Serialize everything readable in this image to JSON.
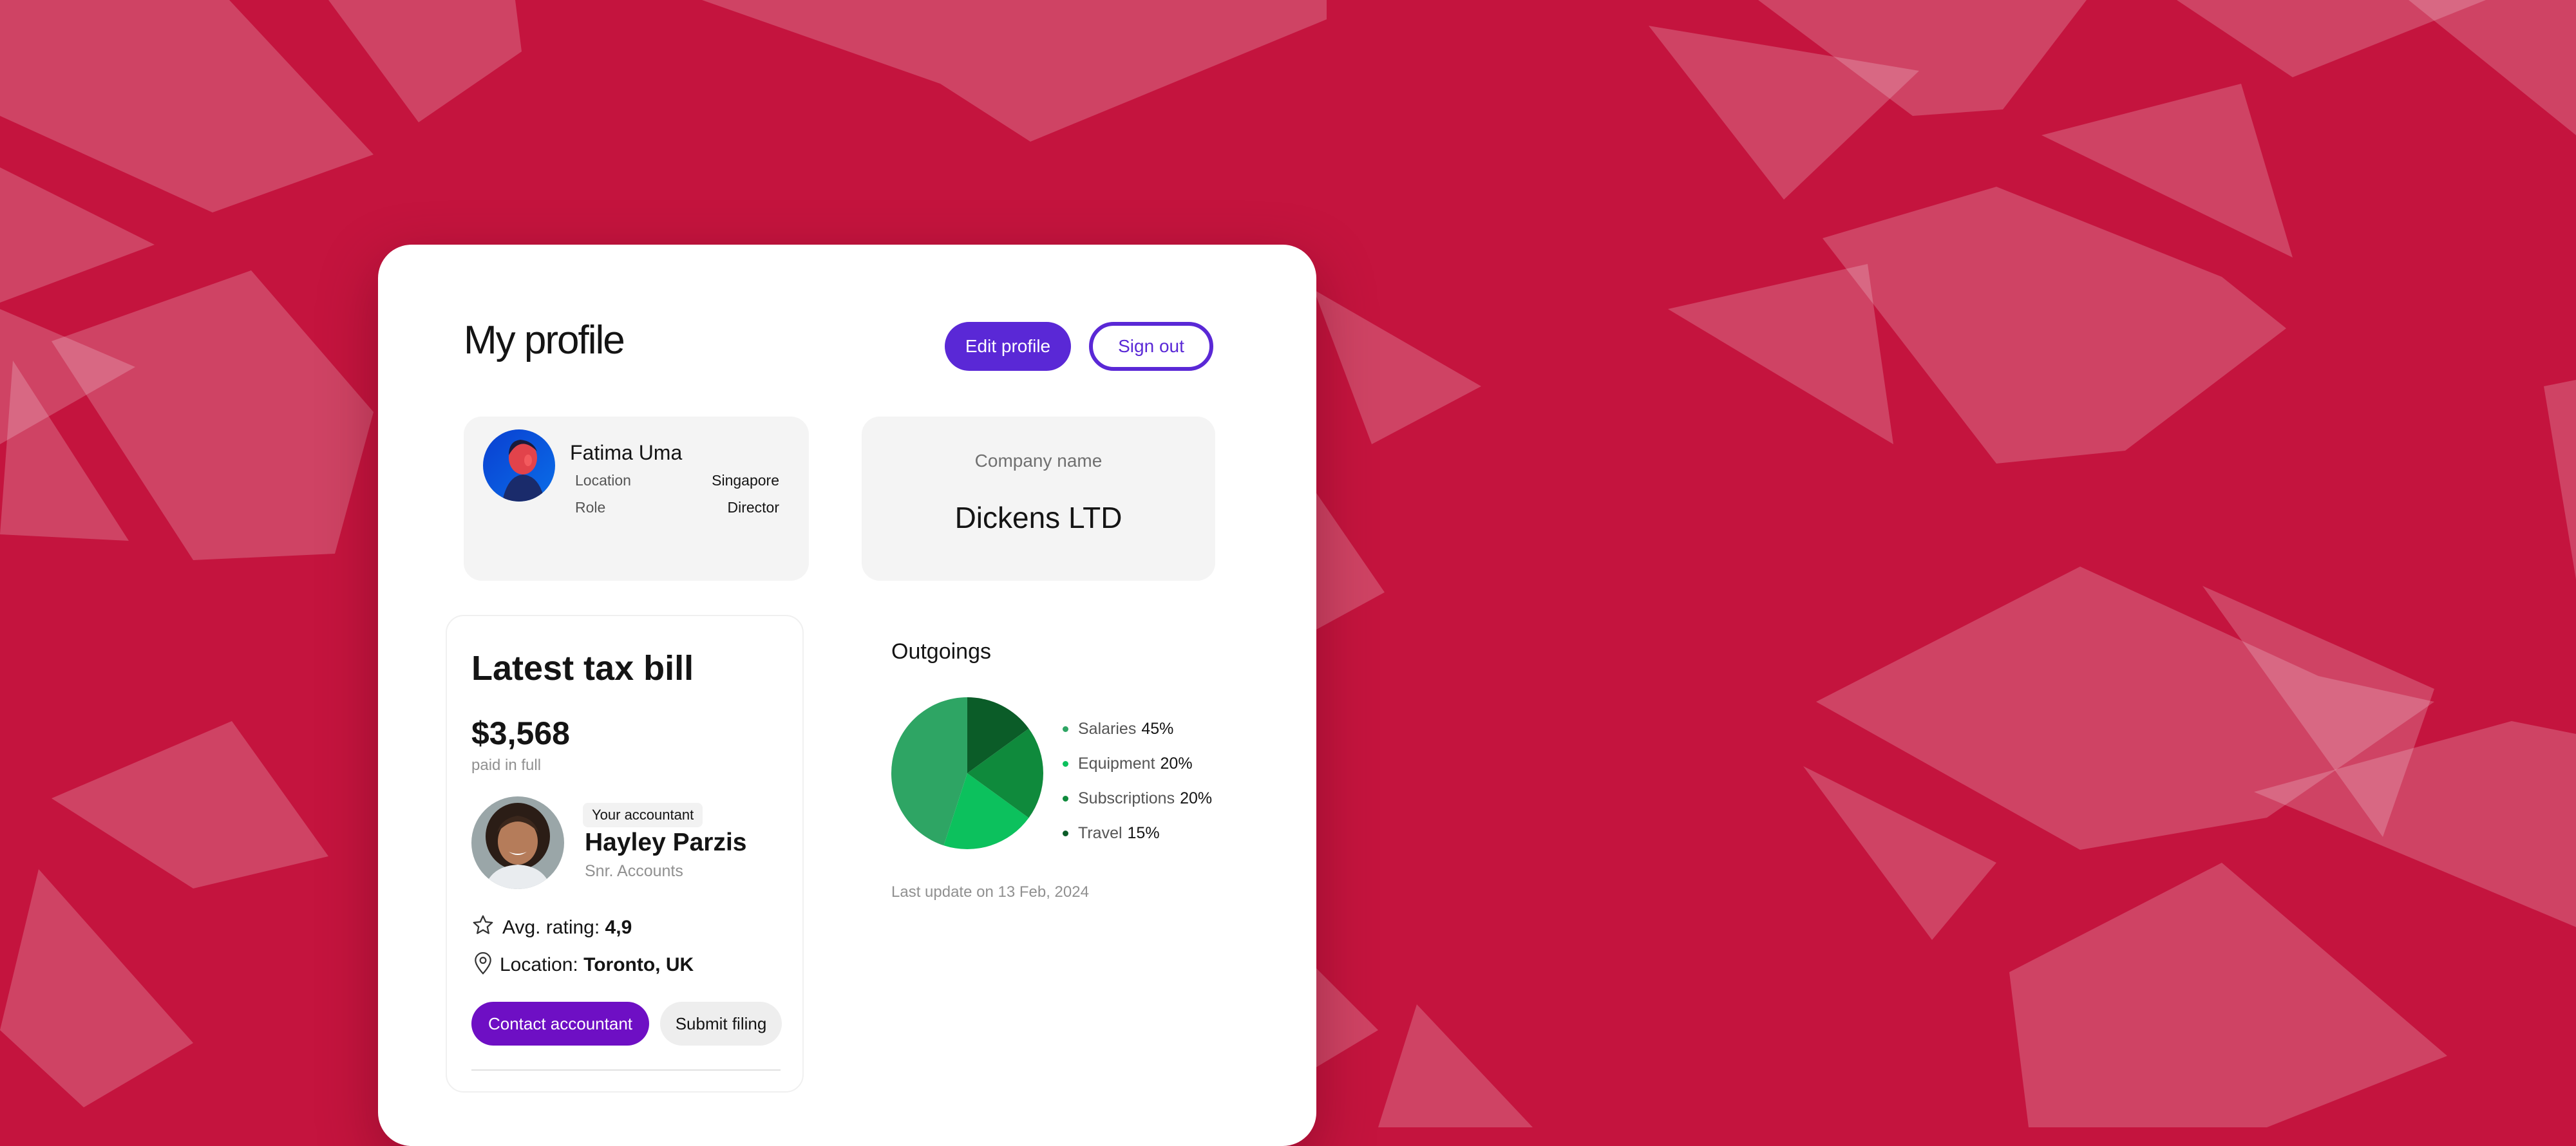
{
  "header": {
    "title": "My profile",
    "edit_label": "Edit profile",
    "signout_label": "Sign out"
  },
  "user": {
    "name": "Fatima Uma",
    "location_label": "Location",
    "location_value": "Singapore",
    "role_label": "Role",
    "role_value": "Director"
  },
  "company": {
    "label": "Company name",
    "name": "Dickens LTD"
  },
  "tax": {
    "title": "Latest tax bill",
    "amount": "$3,568",
    "status": "paid in full",
    "accountant_badge": "Your accountant",
    "accountant_name": "Hayley Parzis",
    "accountant_role": "Snr. Accounts",
    "rating_label": "Avg. rating: ",
    "rating_value": "4,9",
    "location_label": "Location: ",
    "location_value": "Toronto, UK",
    "contact_label": "Contact accountant",
    "submit_label": "Submit filing"
  },
  "outgoings": {
    "title": "Outgoings",
    "last_update": "Last update on 13 Feb, 2024"
  },
  "chart_data": {
    "type": "pie",
    "categories": [
      "Salaries",
      "Equipment",
      "Subscriptions",
      "Travel"
    ],
    "values": [
      45,
      20,
      20,
      15
    ],
    "value_labels": [
      "45%",
      "20%",
      "20%",
      "15%"
    ],
    "colors": [
      "#2ea564",
      "#0cc15d",
      "#0f8a3c",
      "#0b5c28"
    ],
    "title": "Outgoings",
    "legend": "right"
  },
  "theme": {
    "background": "#c4143e",
    "accent": "#5a28d6",
    "contact_button": "#6e0fc4"
  }
}
